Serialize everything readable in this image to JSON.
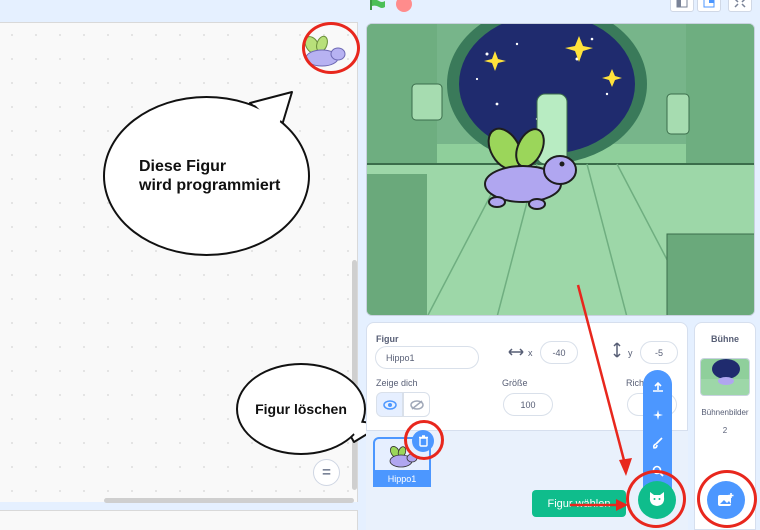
{
  "annotations": {
    "bubble_sprite_line1": "Diese Figur",
    "bubble_sprite_line2": "wird programmiert",
    "bubble_delete": "Figur löschen"
  },
  "code_area": {
    "zoom_reset_label": "="
  },
  "sprite_info": {
    "figur_label": "Figur",
    "sprite_name": "Hippo1",
    "x_label": "x",
    "x_value": "-40",
    "y_label": "y",
    "y_value": "-5",
    "show_label": "Zeige dich",
    "size_label": "Größe",
    "size_value": "100",
    "direction_label_partial": "Rich"
  },
  "sprite_list": [
    {
      "name": "Hippo1"
    }
  ],
  "stage_panel": {
    "title": "Bühne",
    "backdrops_label": "Bühnenbilder",
    "backdrops_count": "2"
  },
  "add_sprite_menu": {
    "tooltip": "Figur wählen",
    "items": [
      "upload-icon",
      "surprise-icon",
      "paint-icon",
      "search-icon"
    ]
  },
  "colors": {
    "accent_blue": "#4c97ff",
    "accent_green": "#0fbd8c",
    "annotation_red": "#e8271d"
  }
}
